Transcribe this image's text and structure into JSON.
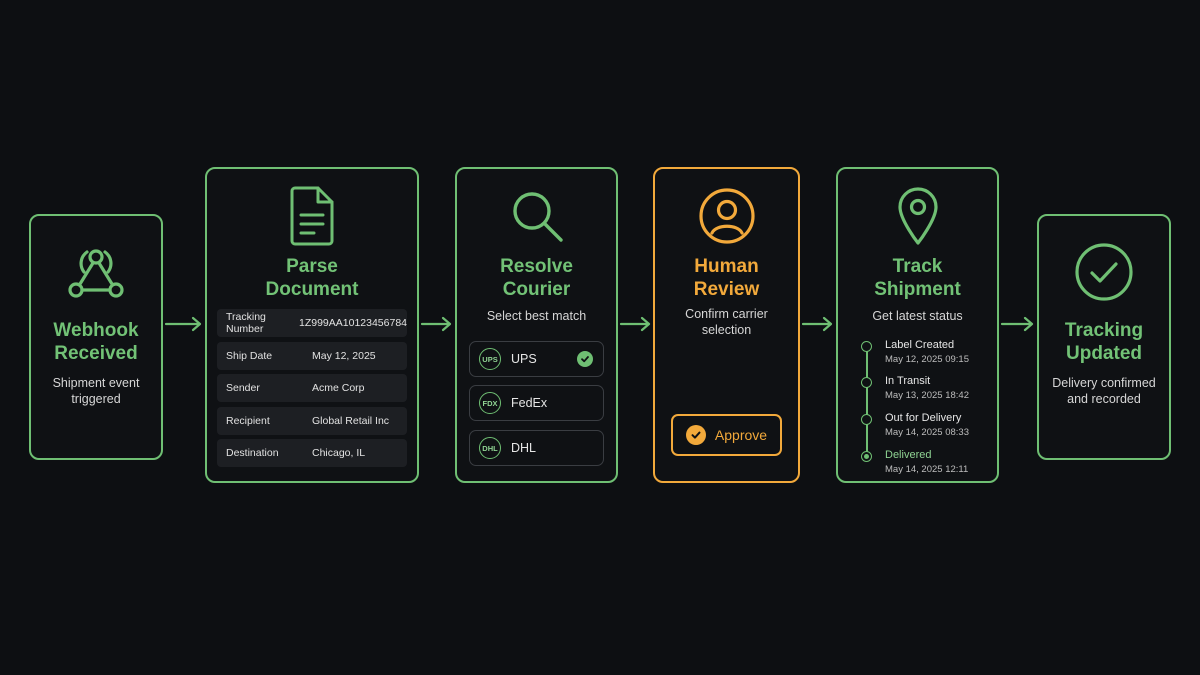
{
  "colors": {
    "accent": "#6fbf73",
    "review": "#f2a93b",
    "background": "#0d0f12"
  },
  "steps": [
    {
      "title": [
        "Webhook",
        "Received"
      ],
      "subtitle": [
        "Shipment event",
        "triggered"
      ],
      "icon": "webhook-icon"
    },
    {
      "title": [
        "Parse",
        "Document"
      ],
      "icon": "document-icon",
      "fields": [
        {
          "key": "Tracking Number",
          "value": "1Z999AA10123456784"
        },
        {
          "key": "Ship Date",
          "value": "May 12, 2025"
        },
        {
          "key": "Sender",
          "value": "Acme Corp"
        },
        {
          "key": "Recipient",
          "value": "Global Retail Inc"
        },
        {
          "key": "Destination",
          "value": "Chicago, IL"
        }
      ]
    },
    {
      "title": [
        "Resolve",
        "Courier"
      ],
      "subtitle": [
        "Select best match"
      ],
      "icon": "search-icon",
      "options": [
        {
          "badge": "UPS",
          "name": "UPS",
          "selected": true
        },
        {
          "badge": "FDX",
          "name": "FedEx",
          "selected": false
        },
        {
          "badge": "DHL",
          "name": "DHL",
          "selected": false
        }
      ]
    },
    {
      "title": [
        "Human",
        "Review"
      ],
      "subtitle": [
        "Confirm carrier",
        "selection"
      ],
      "icon": "user-icon",
      "button": "Approve"
    },
    {
      "title": [
        "Track",
        "Shipment"
      ],
      "subtitle": [
        "Get latest status"
      ],
      "icon": "location-pin-icon",
      "timeline": [
        {
          "label": "Label Created",
          "time": "May 12, 2025  09:15"
        },
        {
          "label": "In Transit",
          "time": "May 13, 2025  18:42"
        },
        {
          "label": "Out for Delivery",
          "time": "May 14, 2025  08:33"
        },
        {
          "label": "Delivered",
          "time": "May 14, 2025  12:11"
        }
      ]
    },
    {
      "title": [
        "Tracking",
        "Updated"
      ],
      "subtitle": [
        "Delivery confirmed",
        "and recorded"
      ],
      "icon": "check-circle-icon"
    }
  ]
}
